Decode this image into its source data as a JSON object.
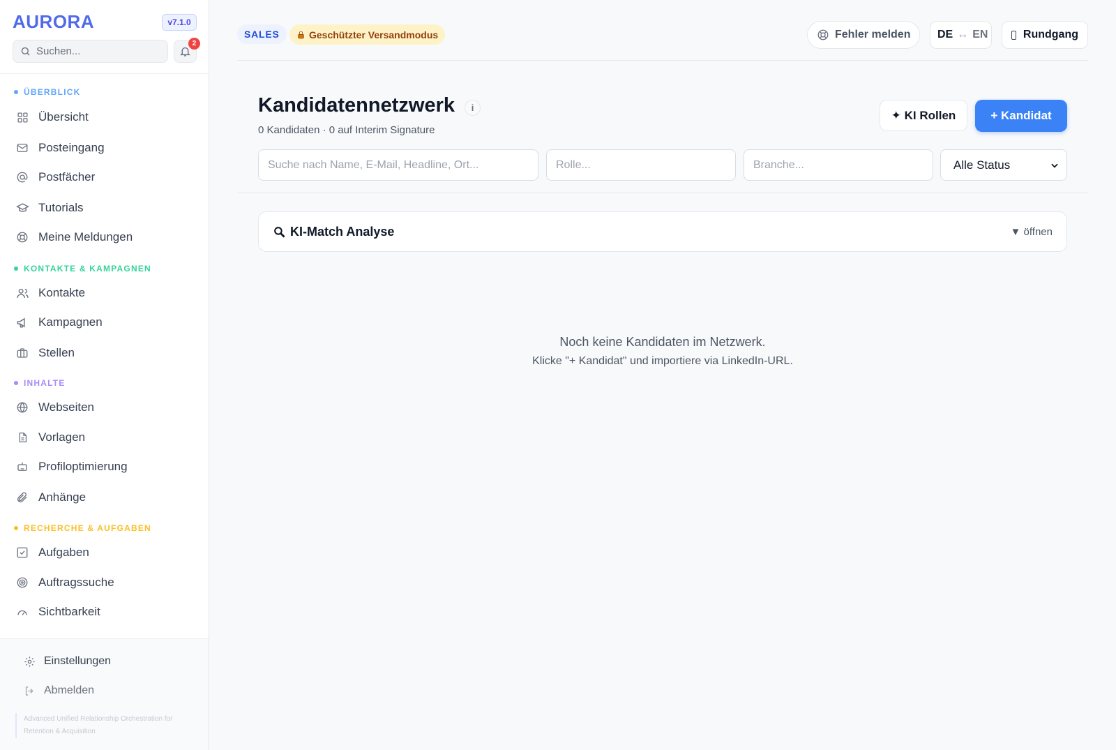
{
  "app": {
    "brand": "AURORA",
    "version": "v7.1.0"
  },
  "sidebar": {
    "search_placeholder": "Suchen...",
    "notifications_count": "2",
    "sections": [
      {
        "label": "ÜBERBLICK",
        "color": "#60a5fa"
      },
      {
        "label": "KONTAKTE & KAMPAGNEN",
        "color": "#34d399"
      },
      {
        "label": "INHALTE",
        "color": "#a78bfa"
      },
      {
        "label": "RECHERCHE & AUFGABEN",
        "color": "#fbbf24"
      }
    ],
    "items": [
      {
        "label": "Übersicht",
        "icon": "grid-icon"
      },
      {
        "label": "Posteingang",
        "icon": "mail-icon"
      },
      {
        "label": "Postfächer",
        "icon": "at-icon"
      },
      {
        "label": "Tutorials",
        "icon": "graduation-cap-icon"
      },
      {
        "label": "Meine Meldungen",
        "icon": "lifebuoy-icon"
      },
      {
        "label": "Kontakte",
        "icon": "users-icon"
      },
      {
        "label": "Kampagnen",
        "icon": "megaphone-icon"
      },
      {
        "label": "Stellen",
        "icon": "briefcase-icon"
      },
      {
        "label": "Webseiten",
        "icon": "globe-icon"
      },
      {
        "label": "Vorlagen",
        "icon": "document-icon"
      },
      {
        "label": "Profiloptimierung",
        "icon": "robot-icon"
      },
      {
        "label": "Anhänge",
        "icon": "paperclip-icon"
      },
      {
        "label": "Aufgaben",
        "icon": "checkbox-icon"
      },
      {
        "label": "Auftragssuche",
        "icon": "target-icon"
      },
      {
        "label": "Sichtbarkeit",
        "icon": "gauge-icon"
      }
    ],
    "footer": {
      "settings": "Einstellungen",
      "logout": "Abmelden",
      "tagline": "Advanced Unified Relationship Orchestration for Retention & Acquisition"
    }
  },
  "topbar": {
    "mode_label": "SALES",
    "protected_label": "Geschützter Versandmodus",
    "report_bug": "Fehler melden",
    "lang_from": "DE",
    "lang_arrow": "↔",
    "lang_to": "EN",
    "tour": "Rundgang"
  },
  "page": {
    "title": "Kandidatennetzwerk",
    "info": "i",
    "subtitle": "0 Kandidaten · 0 auf Interim Signature",
    "btn_ai_roles": "✦ KI Rollen",
    "btn_add_candidate": "+ Kandidat",
    "filters": {
      "search_placeholder": "Suche nach Name, E-Mail, Headline, Ort...",
      "role_placeholder": "Rolle...",
      "industry_placeholder": "Branche...",
      "status_selected": "Alle Status"
    },
    "match_panel": {
      "title": "KI-Match Analyse",
      "toggle": "▼ öffnen"
    },
    "empty_state": {
      "line1": "Noch keine Kandidaten im Netzwerk.",
      "line2": "Klicke \"+ Kandidat\" und importiere via LinkedIn-URL."
    }
  },
  "colors": {
    "brand": "#4f6bea",
    "primary": "#3b82f6",
    "badge": "#ef4444"
  }
}
